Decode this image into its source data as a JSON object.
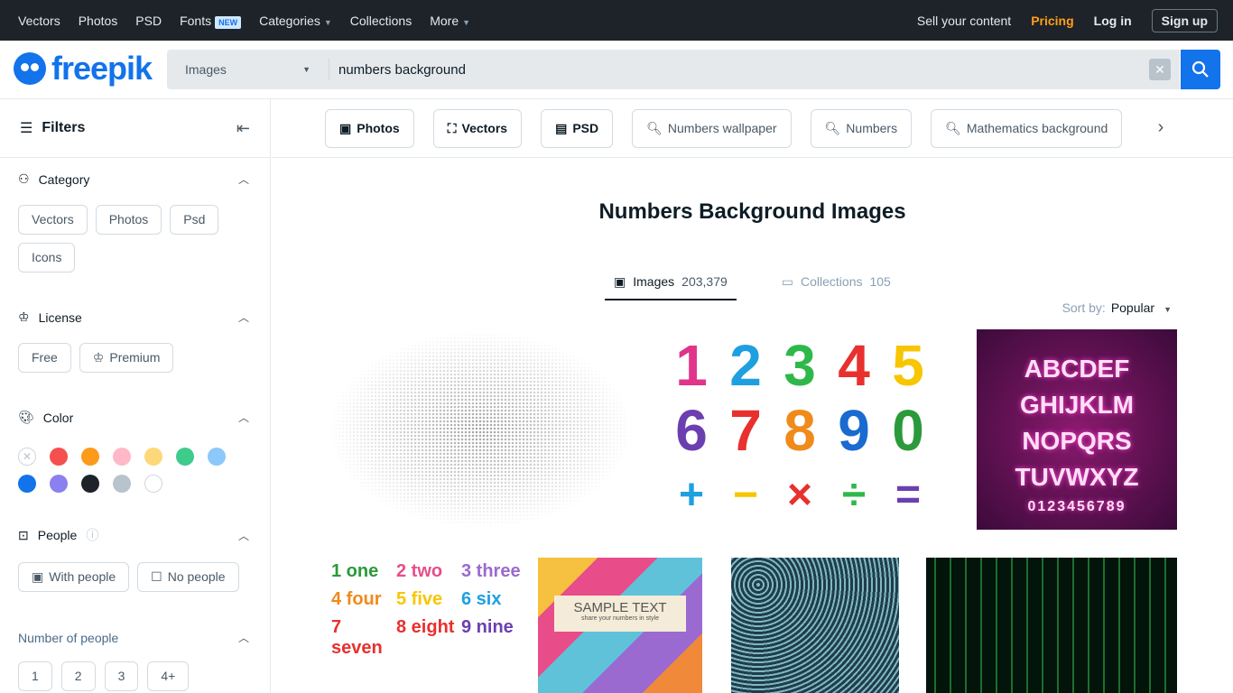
{
  "topbar": {
    "nav": [
      "Vectors",
      "Photos",
      "PSD",
      "Fonts",
      "Categories",
      "Collections",
      "More"
    ],
    "fonts_badge": "NEW",
    "sell": "Sell your content",
    "pricing": "Pricing",
    "login": "Log in",
    "signup": "Sign up"
  },
  "logo": "freepik",
  "search": {
    "type": "Images",
    "value": "numbers background"
  },
  "filters": {
    "title": "Filters",
    "category": {
      "title": "Category",
      "options": [
        "Vectors",
        "Photos",
        "Psd",
        "Icons"
      ]
    },
    "license": {
      "title": "License",
      "options": [
        "Free",
        "Premium"
      ]
    },
    "color": {
      "title": "Color",
      "swatches": [
        "none",
        "#f64f4f",
        "#fc9a1b",
        "#ffb8c8",
        "#fdd87a",
        "#3fcb8c",
        "#8cc8fa",
        "#1273eb",
        "#8b80ef",
        "#1d2329",
        "#b8c3cc",
        "#ffffff"
      ]
    },
    "people": {
      "title": "People",
      "options": [
        "With people",
        "No people"
      ]
    },
    "number_of_people": {
      "title": "Number of people",
      "options": [
        "1",
        "2",
        "3",
        "4+"
      ]
    }
  },
  "tags": [
    {
      "label": "Photos",
      "icon": "image-icon"
    },
    {
      "label": "Vectors",
      "icon": "vector-icon"
    },
    {
      "label": "PSD",
      "icon": "psd-icon"
    },
    {
      "label": "Numbers wallpaper",
      "icon": "search-icon"
    },
    {
      "label": "Numbers",
      "icon": "search-icon"
    },
    {
      "label": "Mathematics background",
      "icon": "search-icon"
    }
  ],
  "page_title": "Numbers Background Images",
  "result_tabs": [
    {
      "label": "Images",
      "count": "203,379"
    },
    {
      "label": "Collections",
      "count": "105"
    }
  ],
  "sort": {
    "label": "Sort by:",
    "value": "Popular"
  },
  "images": {
    "numbers": [
      "1",
      "2",
      "3",
      "4",
      "5",
      "6",
      "7",
      "8",
      "9",
      "0",
      "+",
      "−",
      "×",
      "÷",
      "=",
      "?"
    ],
    "neon": [
      "ABCDEF",
      "GHIJKLM",
      "NOPQRS",
      "TUVWXYZ",
      "0123456789"
    ],
    "sample": {
      "title": "SAMPLE TEXT",
      "sub": "share your numbers in style"
    },
    "kids": [
      "1 one",
      "2 two",
      "3 three",
      "4 four",
      "5 five",
      "6 six",
      "7 seven",
      "8 eight",
      "9 nine"
    ]
  }
}
